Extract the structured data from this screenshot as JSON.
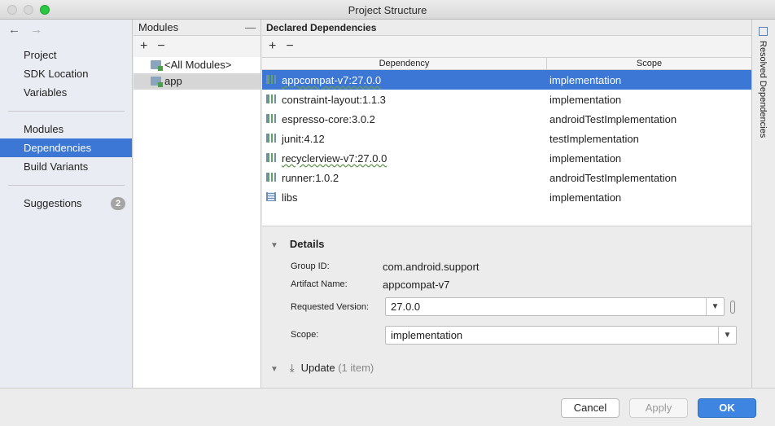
{
  "window": {
    "title": "Project Structure"
  },
  "nav": {
    "back_arrow": "←",
    "forward_arrow": "→",
    "items": [
      {
        "label": "Project"
      },
      {
        "label": "SDK Location"
      },
      {
        "label": "Variables"
      },
      {
        "label": "Modules"
      },
      {
        "label": "Dependencies",
        "selected": true
      },
      {
        "label": "Build Variants"
      },
      {
        "label": "Suggestions",
        "badge": "2"
      }
    ]
  },
  "modules": {
    "header": "Modules",
    "collapse_glyph": "—",
    "add_glyph": "+",
    "remove_glyph": "−",
    "items": [
      {
        "label": "<All Modules>"
      },
      {
        "label": "app",
        "selected": true
      }
    ]
  },
  "dependencies": {
    "header": "Declared Dependencies",
    "add_glyph": "+",
    "remove_glyph": "−",
    "columns": {
      "dependency": "Dependency",
      "scope": "Scope"
    },
    "rows": [
      {
        "name": "appcompat-v7:27.0.0",
        "scope": "implementation",
        "selected": true
      },
      {
        "name": "constraint-layout:1.1.3",
        "scope": "implementation"
      },
      {
        "name": "espresso-core:3.0.2",
        "scope": "androidTestImplementation"
      },
      {
        "name": "junit:4.12",
        "scope": "testImplementation"
      },
      {
        "name": "recyclerview-v7:27.0.0",
        "scope": "implementation"
      },
      {
        "name": "runner:1.0.2",
        "scope": "androidTestImplementation"
      },
      {
        "name": "libs",
        "scope": "implementation"
      }
    ]
  },
  "details": {
    "title": "Details",
    "group_id_label": "Group ID:",
    "group_id": "com.android.support",
    "artifact_label": "Artifact Name:",
    "artifact": "appcompat-v7",
    "requested_version_label": "Requested Version:",
    "requested_version": "27.0.0",
    "scope_label": "Scope:",
    "scope": "implementation"
  },
  "update": {
    "label": "Update",
    "count": "(1 item)"
  },
  "right_tab": {
    "label": "Resolved Dependencies"
  },
  "footer": {
    "cancel": "Cancel",
    "apply": "Apply",
    "ok": "OK"
  },
  "colors": {
    "selection": "#3d77d6",
    "ok_button": "#3d85e0"
  }
}
